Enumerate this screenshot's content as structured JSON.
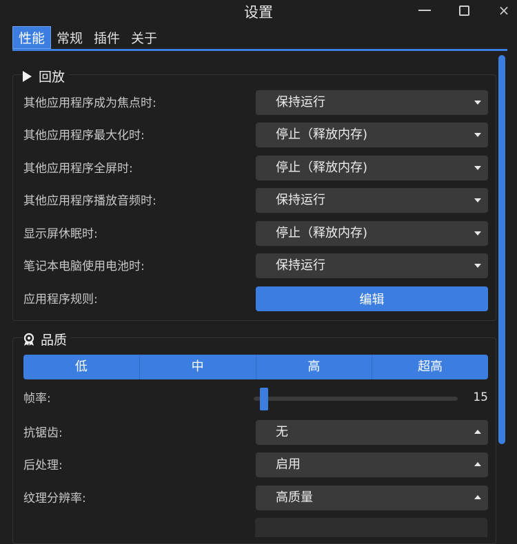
{
  "window": {
    "title": "设置",
    "controls": {
      "minimize": "minimize-icon",
      "maximize": "maximize-icon",
      "close": "×"
    }
  },
  "tabs": [
    {
      "label": "性能",
      "active": true
    },
    {
      "label": "常规",
      "active": false
    },
    {
      "label": "插件",
      "active": false
    },
    {
      "label": "关于",
      "active": false
    }
  ],
  "playback": {
    "title": "回放",
    "icon": "play-icon",
    "rows": [
      {
        "label": "其他应用程序成为焦点时:",
        "value": "保持运行"
      },
      {
        "label": "其他应用程序最大化时:",
        "value": "停止（释放内存)"
      },
      {
        "label": "其他应用程序全屏时:",
        "value": "停止（释放内存)"
      },
      {
        "label": "其他应用程序播放音频时:",
        "value": "保持运行"
      },
      {
        "label": "显示屏休眠时:",
        "value": "停止（释放内存)"
      },
      {
        "label": "笔记本电脑使用电池时:",
        "value": "保持运行"
      }
    ],
    "rules": {
      "label": "应用程序规则:",
      "button": "编辑"
    }
  },
  "quality": {
    "title": "品质",
    "icon": "award-icon",
    "presets": [
      "低",
      "中",
      "高",
      "超高"
    ],
    "framerate": {
      "label": "帧率:",
      "value": "15",
      "level_fraction": 0.03
    },
    "rows": [
      {
        "label": "抗锯齿:",
        "value": "无"
      },
      {
        "label": "后处理:",
        "value": "启用"
      },
      {
        "label": "纹理分辨率:",
        "value": "高质量"
      }
    ]
  },
  "colors": {
    "accent": "#3b7ee0",
    "background": "#1f1f1f",
    "combo": "#3a3a3a"
  }
}
